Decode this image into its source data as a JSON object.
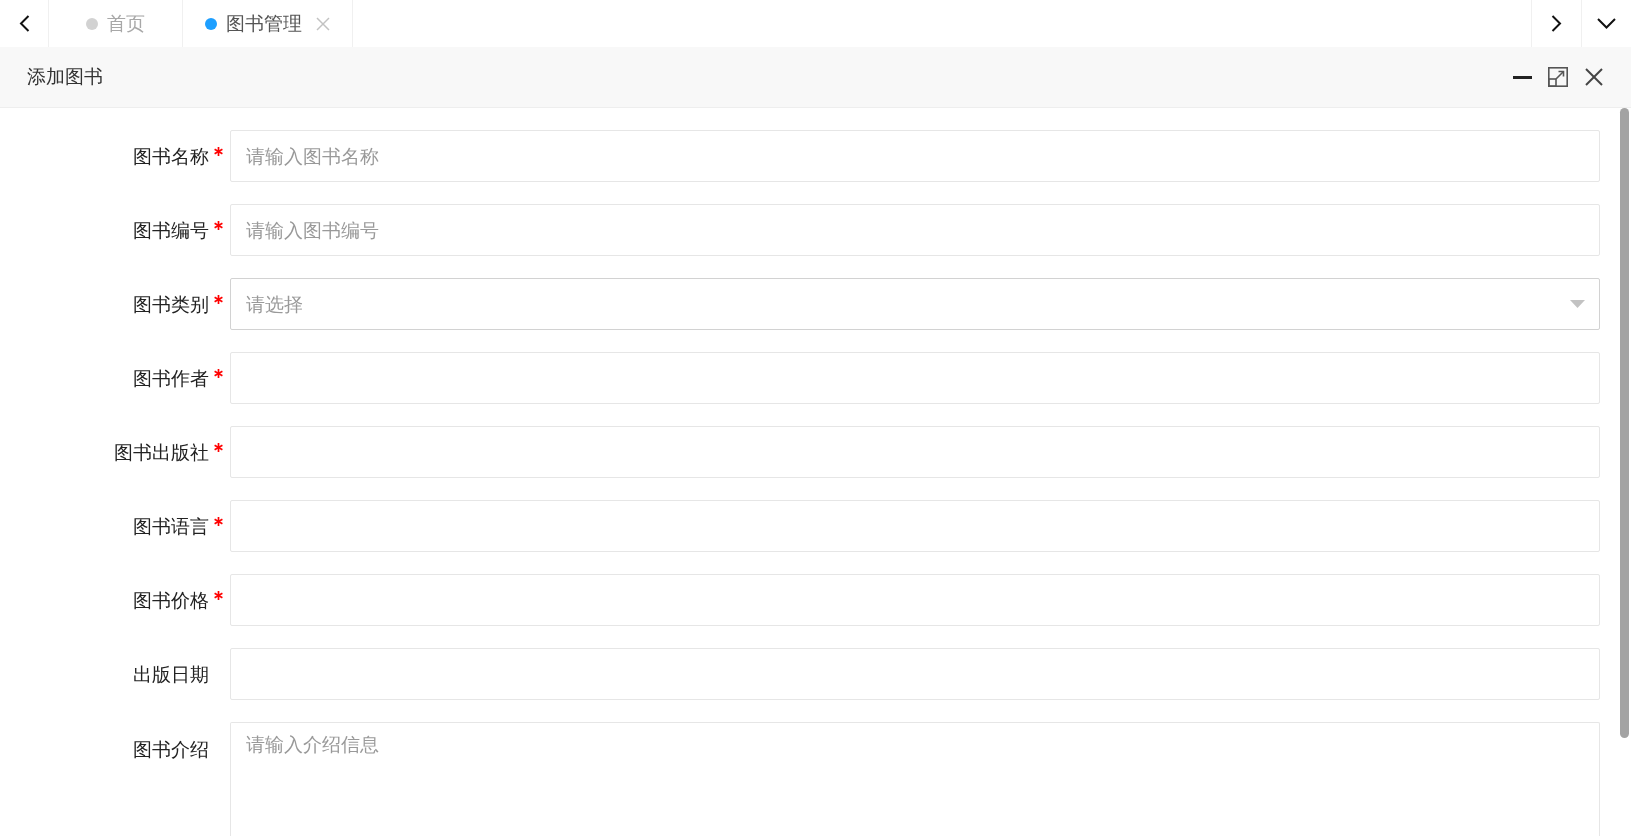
{
  "tab_bar": {
    "tabs": [
      {
        "label": "首页",
        "selected": false,
        "closable": false
      },
      {
        "label": "图书管理",
        "selected": true,
        "closable": true
      }
    ]
  },
  "dialog": {
    "title": "添加图书"
  },
  "form": {
    "fields": [
      {
        "label": "图书名称",
        "required": true,
        "kind": "input",
        "placeholder": "请输入图书名称"
      },
      {
        "label": "图书编号",
        "required": true,
        "kind": "input",
        "placeholder": "请输入图书编号"
      },
      {
        "label": "图书类别",
        "required": true,
        "kind": "select",
        "placeholder": "请选择"
      },
      {
        "label": "图书作者",
        "required": true,
        "kind": "input"
      },
      {
        "label": "图书出版社",
        "required": true,
        "kind": "input"
      },
      {
        "label": "图书语言",
        "required": true,
        "kind": "input"
      },
      {
        "label": "图书价格",
        "required": true,
        "kind": "input"
      },
      {
        "label": "出版日期",
        "required": false,
        "kind": "input"
      },
      {
        "label": "图书介绍",
        "required": false,
        "kind": "textarea",
        "placeholder": "请输入介绍信息"
      }
    ]
  }
}
